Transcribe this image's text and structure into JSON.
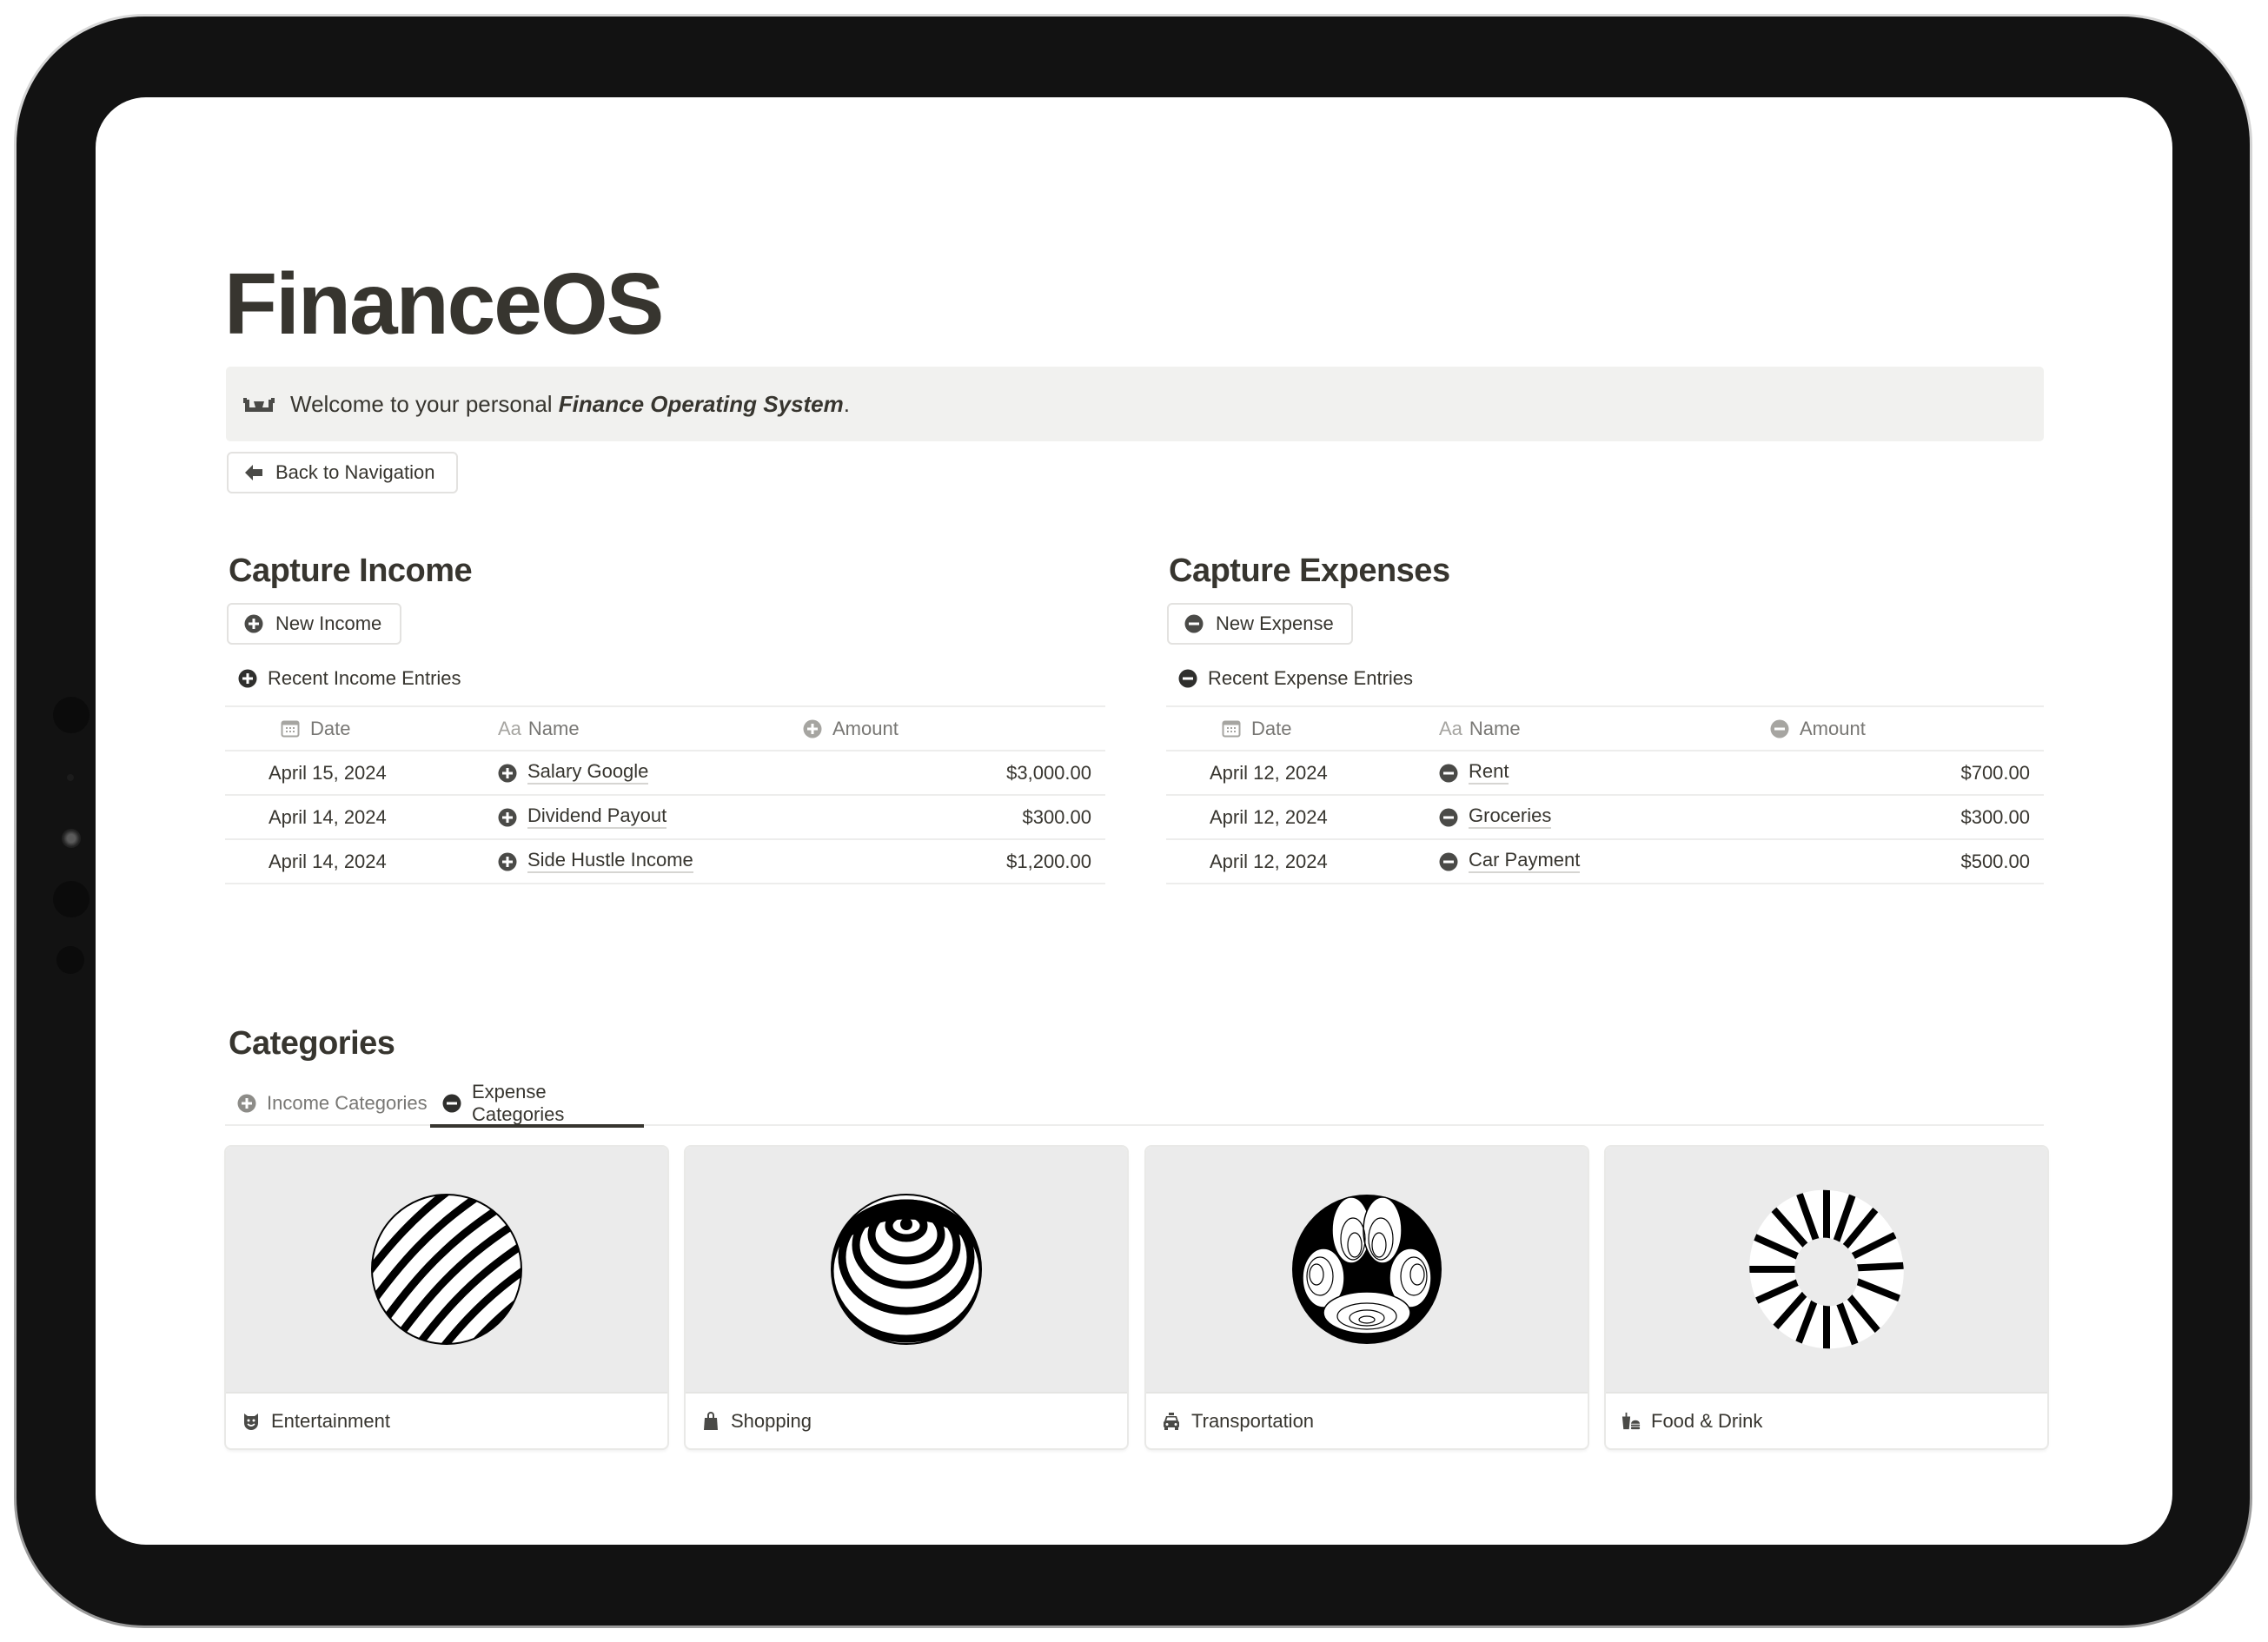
{
  "page": {
    "title": "FinanceOS",
    "callout": {
      "icon": "money-with-wings-icon",
      "text_prefix": "Welcome to your personal ",
      "text_emphasis": "Finance Operating System",
      "text_suffix": "."
    },
    "back_button": {
      "label": "Back to Navigation",
      "icon": "arrow-left-icon"
    }
  },
  "income": {
    "heading": "Capture Income",
    "new_button": {
      "label": "New Income",
      "icon": "plus-circle-icon"
    },
    "view_label": "Recent Income Entries",
    "columns": {
      "date": "Date",
      "name_prefix": "Aa",
      "name": "Name",
      "amount": "Amount"
    },
    "rows": [
      {
        "date": "April 15, 2024",
        "name": "Salary Google",
        "amount": "$3,000.00"
      },
      {
        "date": "April 14, 2024",
        "name": "Dividend Payout",
        "amount": "$300.00"
      },
      {
        "date": "April 14, 2024",
        "name": "Side Hustle Income",
        "amount": "$1,200.00"
      }
    ]
  },
  "expenses": {
    "heading": "Capture Expenses",
    "new_button": {
      "label": "New Expense",
      "icon": "minus-circle-icon"
    },
    "view_label": "Recent Expense Entries",
    "columns": {
      "date": "Date",
      "name_prefix": "Aa",
      "name": "Name",
      "amount": "Amount"
    },
    "rows": [
      {
        "date": "April 12, 2024",
        "name": "Rent",
        "amount": "$700.00"
      },
      {
        "date": "April 12, 2024",
        "name": "Groceries",
        "amount": "$300.00"
      },
      {
        "date": "April 12, 2024",
        "name": "Car Payment",
        "amount": "$500.00"
      }
    ]
  },
  "categories": {
    "heading": "Categories",
    "tabs": [
      {
        "label": "Income Categories",
        "icon": "plus-circle-icon",
        "active": false
      },
      {
        "label": "Expense Categories",
        "icon": "minus-circle-icon",
        "active": true
      }
    ],
    "cards": [
      {
        "label": "Entertainment",
        "icon": "theater-mask-icon",
        "image": "twisted-stripe-sphere"
      },
      {
        "label": "Shopping",
        "icon": "shopping-bag-icon",
        "image": "concentric-ring-sphere"
      },
      {
        "label": "Transportation",
        "icon": "taxi-icon",
        "image": "contour-lobed-sphere"
      },
      {
        "label": "Food & Drink",
        "icon": "food-drink-icon",
        "image": "striped-torus"
      }
    ]
  },
  "colors": {
    "text": "#37352f",
    "muted": "#787774",
    "callout_bg": "#f1f1ef",
    "card_image_bg": "#ebebeb",
    "divider": "#ededec"
  }
}
